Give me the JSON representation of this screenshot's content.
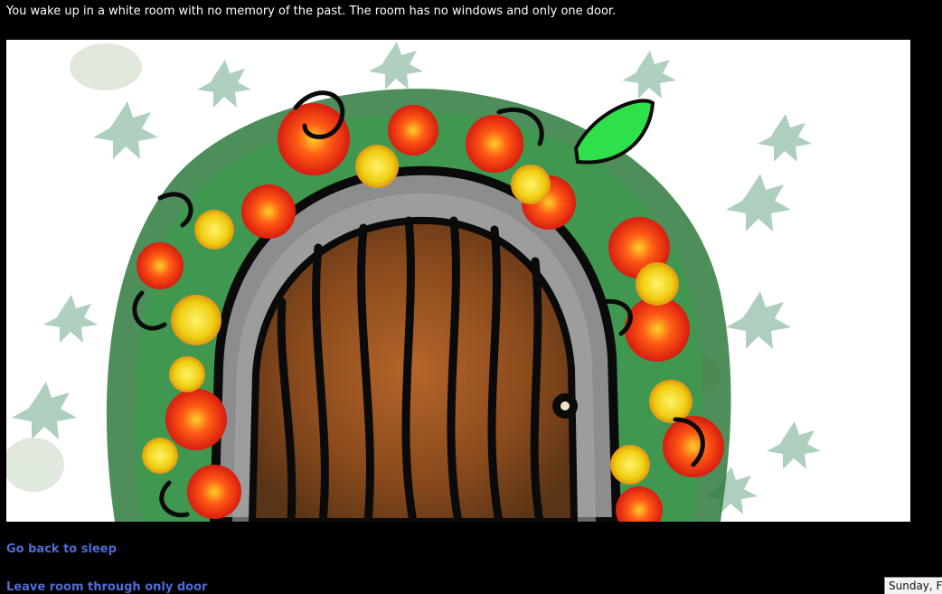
{
  "story": {
    "intro_text": "You wake up in a white room with no memory of the past. The room has no windows and only one door."
  },
  "scene": {
    "image_name": "door-with-flowers-illustration",
    "colors": {
      "background": "#ffffff",
      "door_wood": "#8a4a1c",
      "stone_frame": "#8d8d8d",
      "leaf_green": "#4f9a6e",
      "flower_red": "#e8281c",
      "flower_yellow": "#f2d21a",
      "outline": "#0a0a0a"
    }
  },
  "choices": [
    {
      "label": "Go back to sleep"
    },
    {
      "label": "Leave room through only door"
    }
  ],
  "tooltip": {
    "date_text": "Sunday, Fel"
  },
  "theme": {
    "page_background": "#000000",
    "text_color": "#ffffff",
    "link_color": "#4f6bd8"
  }
}
